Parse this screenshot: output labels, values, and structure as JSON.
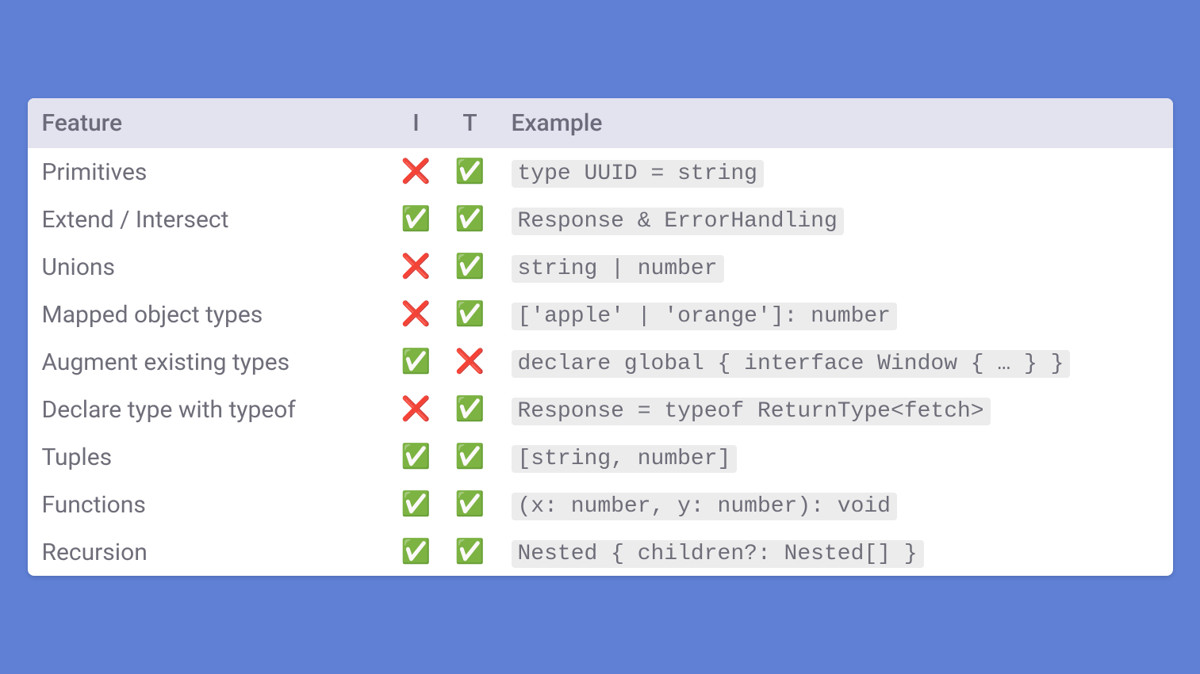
{
  "table": {
    "headers": {
      "feature": "Feature",
      "i": "I",
      "t": "T",
      "example": "Example"
    },
    "rows": [
      {
        "feature": "Primitives",
        "i": "❌",
        "t": "✅",
        "example": "type UUID = string"
      },
      {
        "feature": "Extend / Intersect",
        "i": "✅",
        "t": "✅",
        "example": "Response & ErrorHandling"
      },
      {
        "feature": "Unions",
        "i": "❌",
        "t": "✅",
        "example": "string | number"
      },
      {
        "feature": "Mapped object types",
        "i": "❌",
        "t": "✅",
        "example": "['apple' | 'orange']: number"
      },
      {
        "feature": "Augment existing types",
        "i": "✅",
        "t": "❌",
        "example": "declare global { interface Window { … } }"
      },
      {
        "feature": "Declare type with typeof",
        "i": "❌",
        "t": "✅",
        "example": "Response = typeof ReturnType<fetch>"
      },
      {
        "feature": "Tuples",
        "i": "✅",
        "t": "✅",
        "example": "[string, number]"
      },
      {
        "feature": "Functions",
        "i": "✅",
        "t": "✅",
        "example": "(x: number, y: number): void"
      },
      {
        "feature": "Recursion",
        "i": "✅",
        "t": "✅",
        "example": "Nested { children?: Nested[] }"
      }
    ]
  }
}
